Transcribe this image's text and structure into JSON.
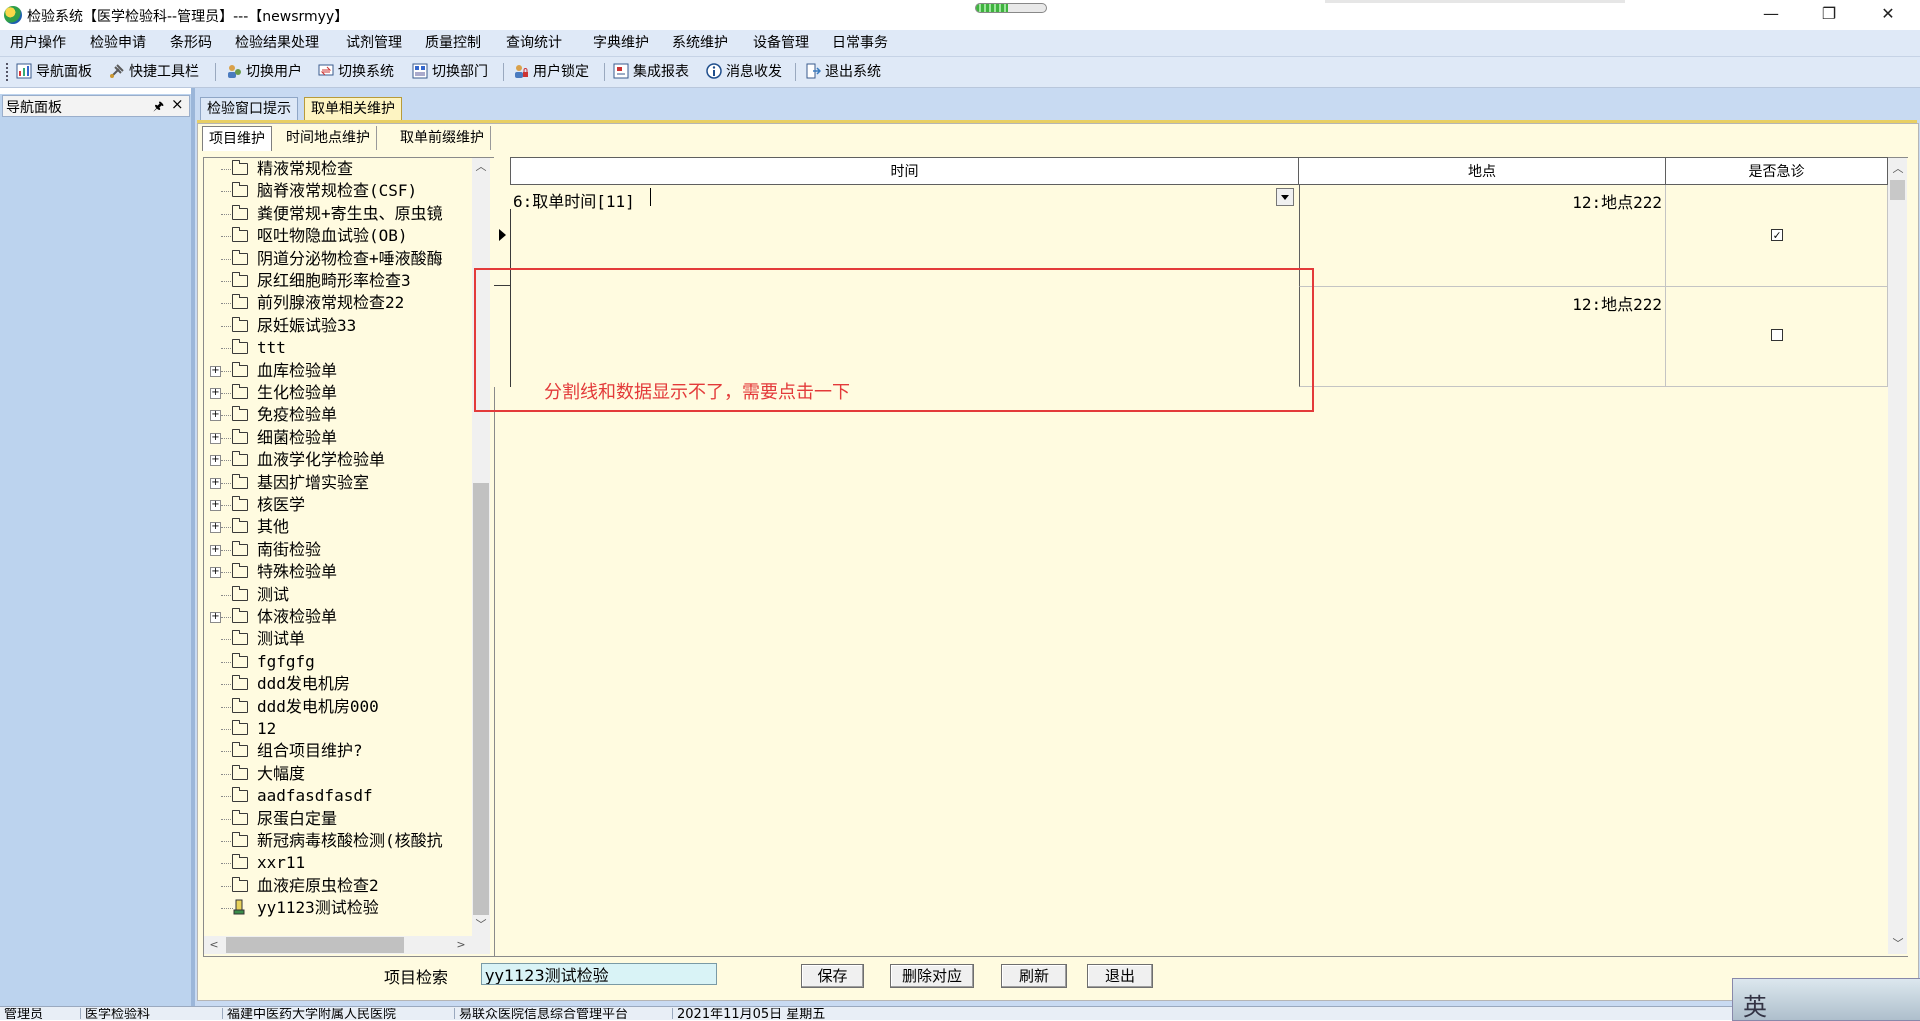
{
  "window": {
    "title": "检验系统【医学检验科--管理员】---【newsrmyy】",
    "minimize": "—",
    "restore": "❐",
    "close": "✕",
    "progress": 0.45
  },
  "menu": [
    "用户操作",
    "检验申请",
    "条形码",
    "检验结果处理",
    "试剂管理",
    "质量控制",
    "查询统计",
    "字典维护",
    "系统维护",
    "设备管理",
    "日常事务"
  ],
  "toolbar": [
    "导航面板",
    "快捷工具栏",
    "切换用户",
    "切换系统",
    "切换部门",
    "用户锁定",
    "集成报表",
    "消息收发",
    "退出系统"
  ],
  "nav_panel": {
    "title": "导航面板",
    "pin": "🖈",
    "close": "×"
  },
  "outer_tabs": [
    "检验窗口提示",
    "取单相关维护"
  ],
  "inner_tabs": [
    "项目维护",
    "时间地点维护",
    "取单前缀维护"
  ],
  "tree": [
    {
      "label": "精液常规检查",
      "expandable": false
    },
    {
      "label": "脑脊液常规检查(CSF)",
      "expandable": false
    },
    {
      "label": "粪便常规+寄生虫、原虫镜",
      "expandable": false
    },
    {
      "label": "呕吐物隐血试验(OB)",
      "expandable": false
    },
    {
      "label": "阴道分泌物检查+唾液酸酶",
      "expandable": false
    },
    {
      "label": "尿红细胞畸形率检查3",
      "expandable": false
    },
    {
      "label": "前列腺液常规检查22",
      "expandable": false
    },
    {
      "label": "尿妊娠试验33",
      "expandable": false
    },
    {
      "label": "ttt",
      "expandable": false
    },
    {
      "label": "血库检验单",
      "expandable": true
    },
    {
      "label": "生化检验单",
      "expandable": true
    },
    {
      "label": "免疫检验单",
      "expandable": true
    },
    {
      "label": "细菌检验单",
      "expandable": true
    },
    {
      "label": "血液学化学检验单",
      "expandable": true
    },
    {
      "label": "基因扩增实验室",
      "expandable": true
    },
    {
      "label": "核医学",
      "expandable": true
    },
    {
      "label": "其他",
      "expandable": true
    },
    {
      "label": "南街检验",
      "expandable": true
    },
    {
      "label": "特殊检验单",
      "expandable": true
    },
    {
      "label": "测试",
      "expandable": false
    },
    {
      "label": "体液检验单",
      "expandable": true
    },
    {
      "label": "测试单",
      "expandable": false
    },
    {
      "label": " fgfgfg",
      "expandable": false
    },
    {
      "label": "ddd发电机房",
      "expandable": false
    },
    {
      "label": "ddd发电机房000",
      "expandable": false
    },
    {
      "label": "12",
      "expandable": false
    },
    {
      "label": "组合项目维护?",
      "expandable": false
    },
    {
      "label": " 大幅度",
      "expandable": false
    },
    {
      "label": " aadfasdfasdf",
      "expandable": false
    },
    {
      "label": "尿蛋白定量",
      "expandable": false
    },
    {
      "label": "新冠病毒核酸检测(核酸抗",
      "expandable": false
    },
    {
      "label": "xxr11",
      "expandable": false
    },
    {
      "label": "血液疟原虫检查2",
      "expandable": false
    },
    {
      "label": "yy1123测试检验",
      "expandable": false,
      "special": true
    }
  ],
  "grid": {
    "columns": [
      "时间",
      "地点",
      "是否急诊"
    ],
    "rows": [
      {
        "time": "6:取单时间[11]",
        "place": "12:地点222",
        "emergency": true
      },
      {
        "time": "",
        "place": "12:地点222",
        "emergency": false
      }
    ]
  },
  "annotation": "分割线和数据显示不了，需要点击一下",
  "search": {
    "label": "项目检索",
    "value": "yy1123测试检验"
  },
  "buttons": [
    "保存",
    "删除对应",
    "刷新",
    "退出"
  ],
  "status": [
    "管理员",
    "医学检验科",
    "福建中医药大学附属人民医院",
    "易联众医院信息综合管理平台",
    "2021年11月05日 星期五"
  ],
  "corner_text": "英"
}
